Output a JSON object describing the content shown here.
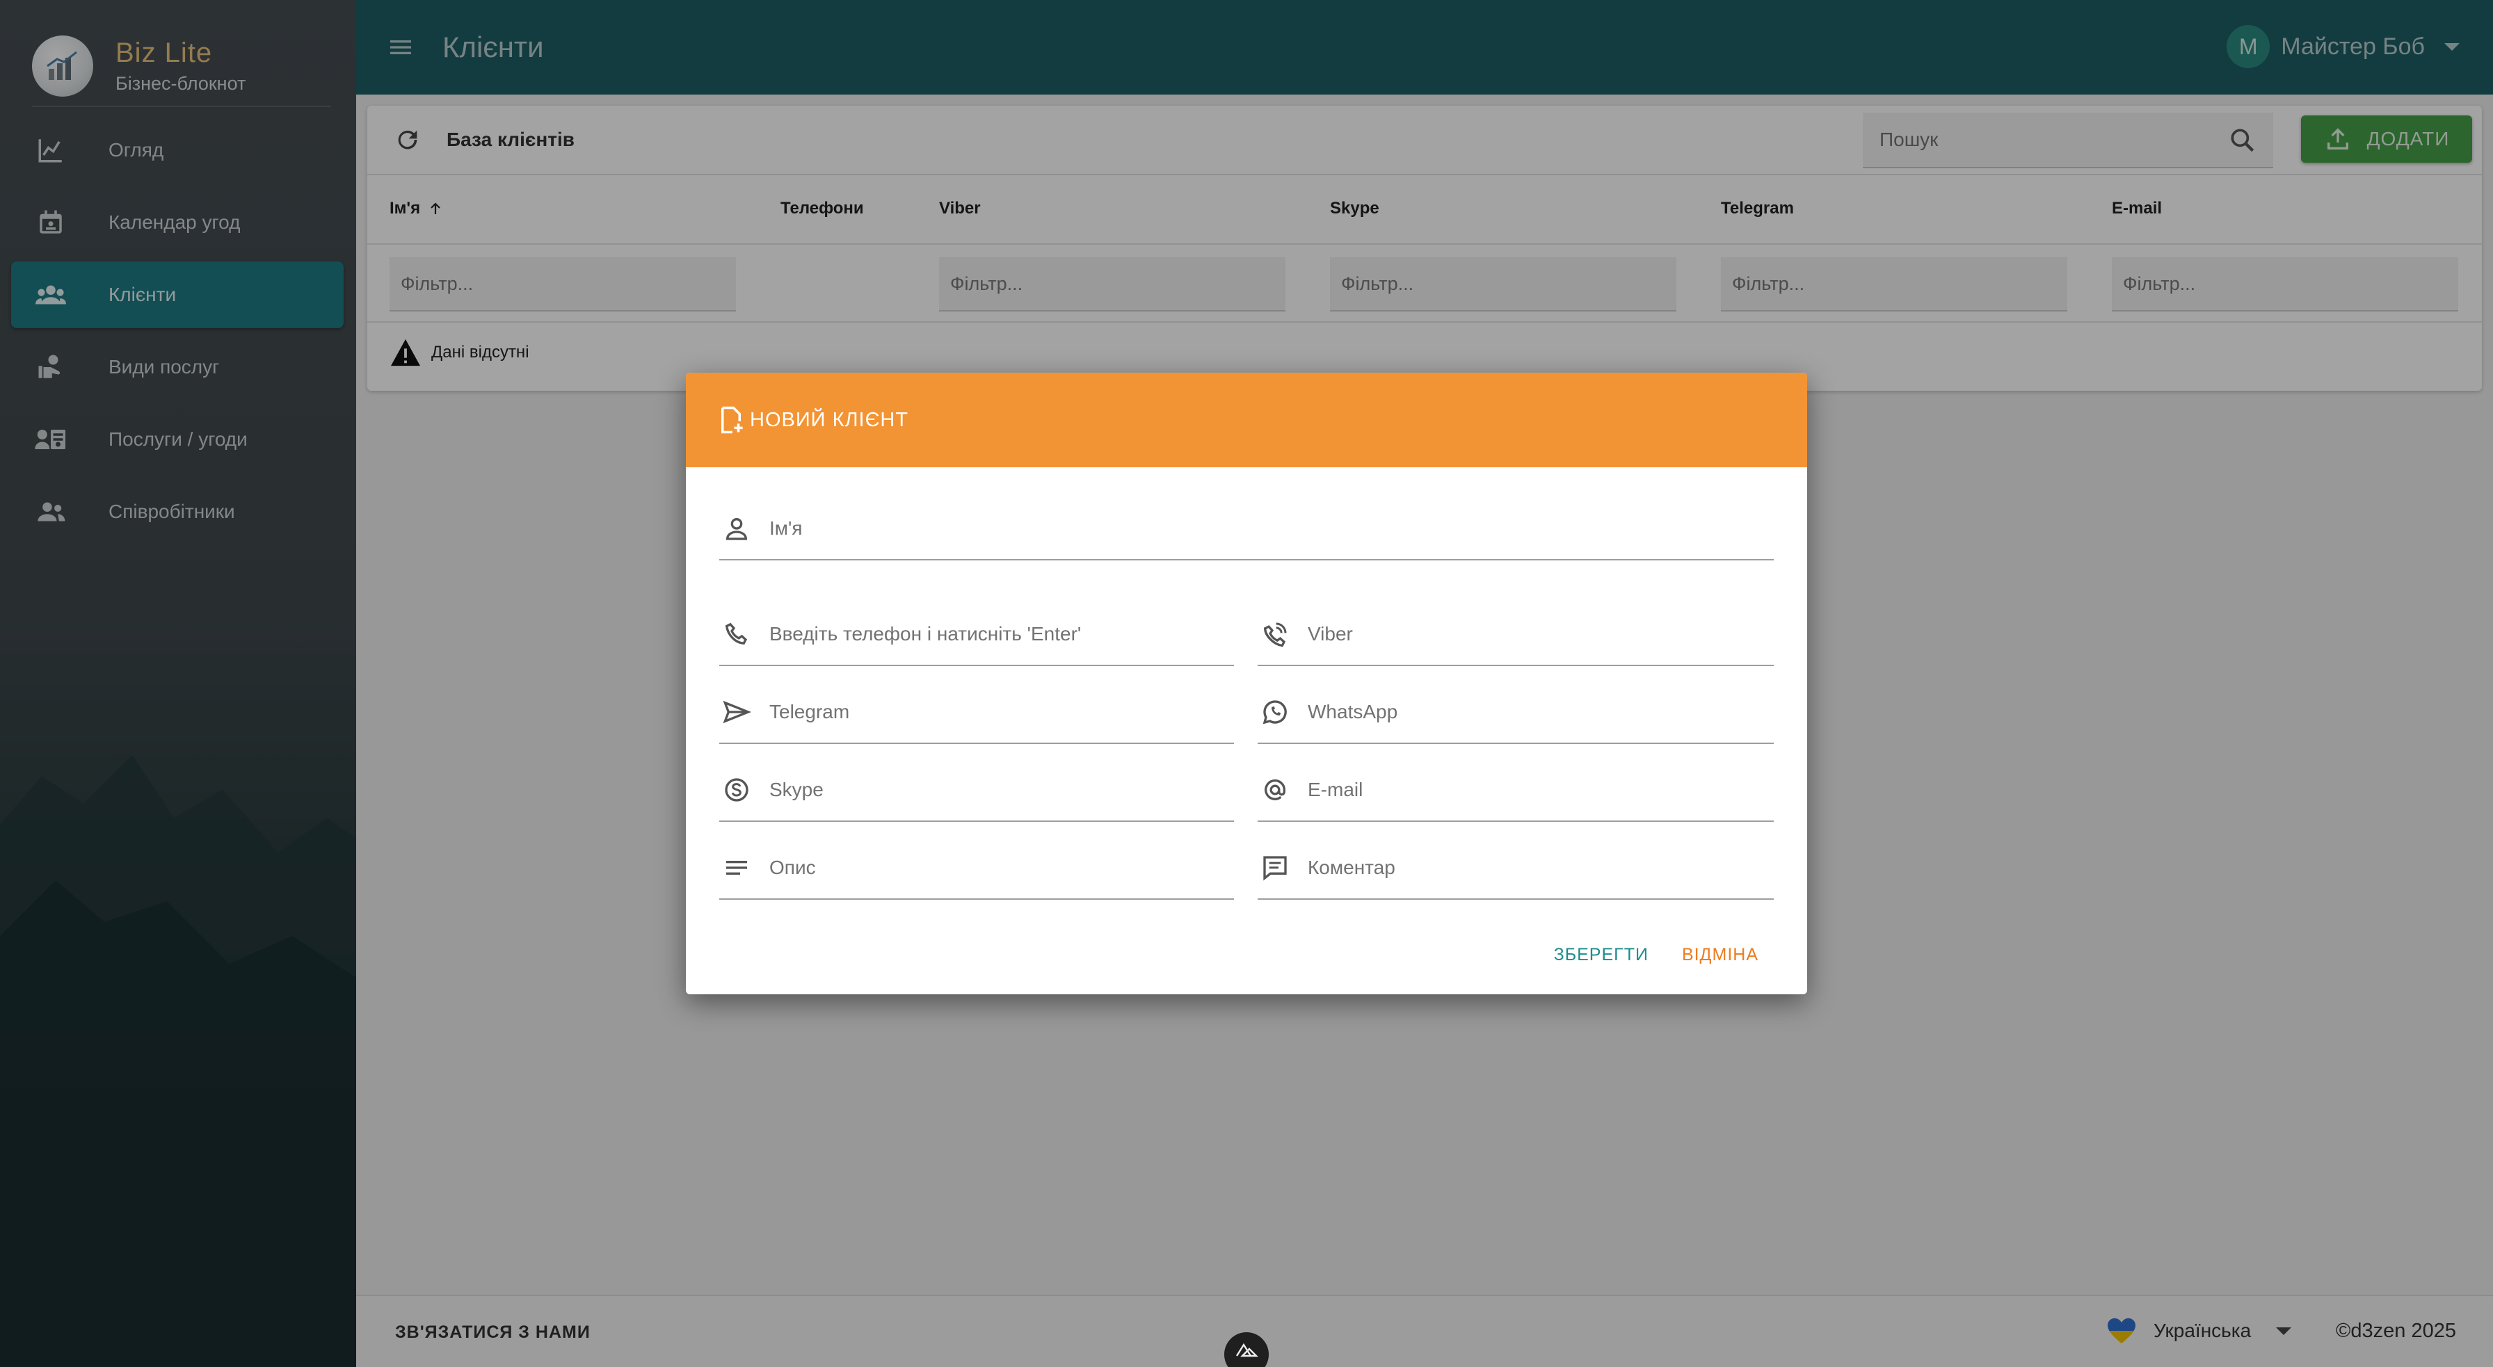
{
  "brand": {
    "name": "Biz Lite",
    "subtitle": "Бізнес-блокнот"
  },
  "sidebar": {
    "items": [
      {
        "label": "Огляд",
        "icon": "chart-line-icon"
      },
      {
        "label": "Календар угод",
        "icon": "calendar-icon"
      },
      {
        "label": "Клієнти",
        "icon": "clients-icon",
        "active": true
      },
      {
        "label": "Види послуг",
        "icon": "service-types-icon"
      },
      {
        "label": "Послуги / угоди",
        "icon": "deals-icon"
      },
      {
        "label": "Співробітники",
        "icon": "employees-icon"
      }
    ]
  },
  "header": {
    "title": "Клієнти",
    "user": {
      "initial": "M",
      "name": "Майстер Боб"
    }
  },
  "clients_card": {
    "title": "База клієнтів",
    "search_placeholder": "Пошук",
    "add_label": "ДОДАТИ",
    "columns": [
      "Ім'я",
      "Телефони",
      "Viber",
      "Skype",
      "Telegram",
      "E-mail"
    ],
    "filter_placeholder": "Фільтр...",
    "no_data": "Дані відсутні"
  },
  "dialog": {
    "title": "НОВИЙ КЛІЄНТ",
    "fields": {
      "name": "Ім'я",
      "phone": "Введіть телефон і натисніть 'Enter'",
      "viber": "Viber",
      "telegram": "Telegram",
      "whatsapp": "WhatsApp",
      "skype": "Skype",
      "email": "E-mail",
      "description": "Опис",
      "comment": "Коментар"
    },
    "save_label": "ЗБЕРЕГТИ",
    "cancel_label": "ВІДМІНА"
  },
  "footer": {
    "contact": "ЗВ'ЯЗАТИСЯ З НАМИ",
    "language": "Українська",
    "copyright": "©d3zen 2025"
  },
  "colors": {
    "topbar": "#1e5e64",
    "active_nav": "#1d7b82",
    "dialog_header": "#f39434",
    "add_button": "#45a049",
    "save": "#1e8c8c",
    "cancel": "#ef7d1f"
  }
}
